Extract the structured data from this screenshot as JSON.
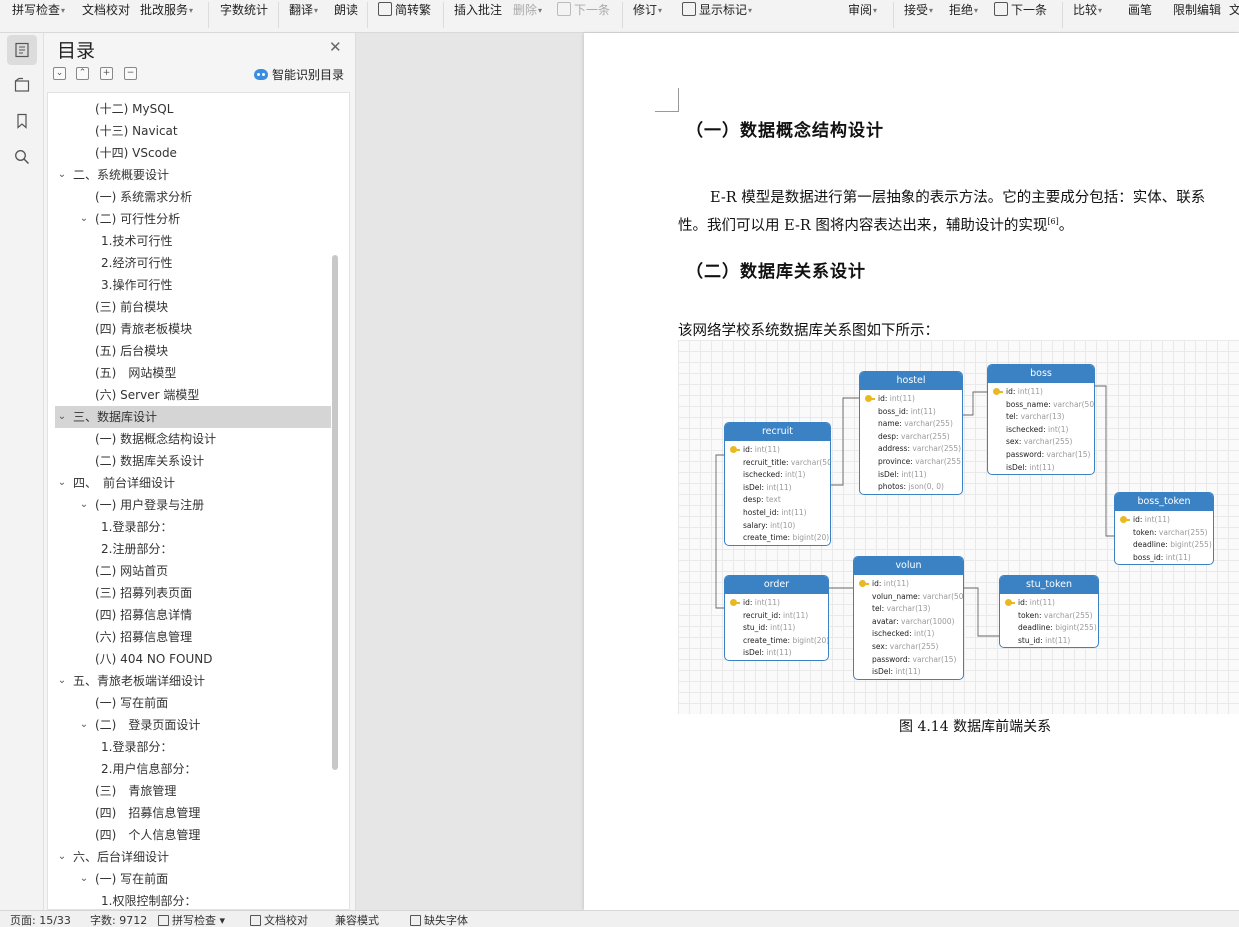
{
  "ribbon": {
    "spell_check": "拼写检查",
    "doc_proof": "文档校对",
    "batch_service": "批改服务",
    "word_count": "字数统计",
    "translate": "翻译",
    "read_aloud": "朗读",
    "simp_trad": "简转繁",
    "insert_comment": "插入批注",
    "delete": "删除",
    "next_comment": "下一条",
    "revise": "修订",
    "show_markup": "显示标记",
    "review": "审阅",
    "accept": "接受",
    "reject": "拒绝",
    "next_change": "下一条",
    "compare": "比较",
    "ink": "画笔",
    "restrict_edit": "限制编辑",
    "more": "文"
  },
  "toc": {
    "title": "目录",
    "smart_toc": "智能识别目录",
    "items": [
      {
        "label": "(十二) MySQL",
        "level": 2,
        "twisty": ""
      },
      {
        "label": "(十三) Navicat",
        "level": 2,
        "twisty": ""
      },
      {
        "label": "(十四) VScode",
        "level": 2,
        "twisty": ""
      },
      {
        "label": "二、系统概要设计",
        "level": 1,
        "twisty": "v"
      },
      {
        "label": "(一) 系统需求分析",
        "level": 2,
        "twisty": ""
      },
      {
        "label": "(二) 可行性分析",
        "level": 2,
        "twisty": "v"
      },
      {
        "label": "1.技术可行性",
        "level": 3,
        "twisty": ""
      },
      {
        "label": "2.经济可行性",
        "level": 3,
        "twisty": ""
      },
      {
        "label": "3.操作可行性",
        "level": 3,
        "twisty": ""
      },
      {
        "label": "(三) 前台模块",
        "level": 2,
        "twisty": ""
      },
      {
        "label": "(四) 青旅老板模块",
        "level": 2,
        "twisty": ""
      },
      {
        "label": "(五) 后台模块",
        "level": 2,
        "twisty": ""
      },
      {
        "label": "(五)　网站模型",
        "level": 2,
        "twisty": ""
      },
      {
        "label": "(六) Server 端模型",
        "level": 2,
        "twisty": ""
      },
      {
        "label": "三、数据库设计",
        "level": 1,
        "twisty": "v",
        "selected": true
      },
      {
        "label": "(一) 数据概念结构设计",
        "level": 2,
        "twisty": ""
      },
      {
        "label": "(二) 数据库关系设计",
        "level": 2,
        "twisty": ""
      },
      {
        "label": "四、　前台详细设计",
        "level": 1,
        "twisty": "v"
      },
      {
        "label": "(一) 用户登录与注册",
        "level": 2,
        "twisty": "v"
      },
      {
        "label": "1.登录部分：",
        "level": 3,
        "twisty": ""
      },
      {
        "label": "2.注册部分：",
        "level": 3,
        "twisty": ""
      },
      {
        "label": "(二) 网站首页",
        "level": 2,
        "twisty": ""
      },
      {
        "label": "(三) 招募列表页面",
        "level": 2,
        "twisty": ""
      },
      {
        "label": "(四) 招募信息详情",
        "level": 2,
        "twisty": ""
      },
      {
        "label": "(六) 招募信息管理",
        "level": 2,
        "twisty": ""
      },
      {
        "label": "(八) 404 NO FOUND",
        "level": 2,
        "twisty": ""
      },
      {
        "label": "五、青旅老板端详细设计",
        "level": 1,
        "twisty": "v"
      },
      {
        "label": "(一) 写在前面",
        "level": 2,
        "twisty": ""
      },
      {
        "label": "(二)　登录页面设计",
        "level": 2,
        "twisty": "v"
      },
      {
        "label": "1.登录部分：",
        "level": 3,
        "twisty": ""
      },
      {
        "label": "2.用户信息部分：",
        "level": 3,
        "twisty": ""
      },
      {
        "label": "(三)　青旅管理",
        "level": 2,
        "twisty": ""
      },
      {
        "label": "(四)　招募信息管理",
        "level": 2,
        "twisty": ""
      },
      {
        "label": "(四)　个人信息管理",
        "level": 2,
        "twisty": ""
      },
      {
        "label": "六、后台详细设计",
        "level": 1,
        "twisty": "v"
      },
      {
        "label": "(一) 写在前面",
        "level": 2,
        "twisty": "v"
      },
      {
        "label": "1.权限控制部分：",
        "level": 3,
        "twisty": ""
      }
    ]
  },
  "doc": {
    "heading1": "（一）数据概念结构设计",
    "para1_line1": "E-R 模型是数据进行第一层抽象的表示方法。它的主要成分包括：实体、联系",
    "para1_line2": "性。我们可以用 E-R 图将内容表达出来，辅助设计的实现",
    "para1_ref": "[6]",
    "para1_end": "。",
    "heading2": "（二）数据库关系设计",
    "para2": "该网络学校系统数据库关系图如下所示：",
    "caption": "图 4.14 数据库前端关系"
  },
  "er": {
    "entities": [
      {
        "name": "hostel",
        "fields": [
          {
            "n": "id",
            "t": "int(11)",
            "pk": true
          },
          {
            "n": "boss_id",
            "t": "int(11)"
          },
          {
            "n": "name",
            "t": "varchar(255)"
          },
          {
            "n": "desp",
            "t": "varchar(255)"
          },
          {
            "n": "address",
            "t": "varchar(255)"
          },
          {
            "n": "province",
            "t": "varchar(255)"
          },
          {
            "n": "isDel",
            "t": "int(11)"
          },
          {
            "n": "photos",
            "t": "json(0, 0)"
          }
        ]
      },
      {
        "name": "boss",
        "fields": [
          {
            "n": "id",
            "t": "int(11)",
            "pk": true
          },
          {
            "n": "boss_name",
            "t": "varchar(50)"
          },
          {
            "n": "tel",
            "t": "varchar(13)"
          },
          {
            "n": "ischecked",
            "t": "int(1)"
          },
          {
            "n": "sex",
            "t": "varchar(255)"
          },
          {
            "n": "password",
            "t": "varchar(15)"
          },
          {
            "n": "isDel",
            "t": "int(11)"
          }
        ]
      },
      {
        "name": "recruit",
        "fields": [
          {
            "n": "id",
            "t": "int(11)",
            "pk": true
          },
          {
            "n": "recruit_title",
            "t": "varchar(50)"
          },
          {
            "n": "ischecked",
            "t": "int(1)"
          },
          {
            "n": "isDel",
            "t": "int(11)"
          },
          {
            "n": "desp",
            "t": "text"
          },
          {
            "n": "hostel_id",
            "t": "int(11)"
          },
          {
            "n": "salary",
            "t": "int(10)"
          },
          {
            "n": "create_time",
            "t": "bigint(20)"
          }
        ]
      },
      {
        "name": "boss_token",
        "fields": [
          {
            "n": "id",
            "t": "int(11)",
            "pk": true
          },
          {
            "n": "token",
            "t": "varchar(255)"
          },
          {
            "n": "deadline",
            "t": "bigint(255)"
          },
          {
            "n": "boss_id",
            "t": "int(11)"
          }
        ]
      },
      {
        "name": "volun",
        "fields": [
          {
            "n": "id",
            "t": "int(11)",
            "pk": true
          },
          {
            "n": "volun_name",
            "t": "varchar(50)"
          },
          {
            "n": "tel",
            "t": "varchar(13)"
          },
          {
            "n": "avatar",
            "t": "varchar(1000)"
          },
          {
            "n": "ischecked",
            "t": "int(1)"
          },
          {
            "n": "sex",
            "t": "varchar(255)"
          },
          {
            "n": "password",
            "t": "varchar(15)"
          },
          {
            "n": "isDel",
            "t": "int(11)"
          }
        ]
      },
      {
        "name": "order",
        "fields": [
          {
            "n": "id",
            "t": "int(11)",
            "pk": true
          },
          {
            "n": "recruit_id",
            "t": "int(11)"
          },
          {
            "n": "stu_id",
            "t": "int(11)"
          },
          {
            "n": "create_time",
            "t": "bigint(20)"
          },
          {
            "n": "isDel",
            "t": "int(11)"
          }
        ]
      },
      {
        "name": "stu_token",
        "fields": [
          {
            "n": "id",
            "t": "int(11)",
            "pk": true
          },
          {
            "n": "token",
            "t": "varchar(255)"
          },
          {
            "n": "deadline",
            "t": "bigint(255)"
          },
          {
            "n": "stu_id",
            "t": "int(11)"
          }
        ]
      }
    ]
  },
  "status": {
    "page": "页面: 15/33",
    "words": "字数: 9712",
    "spell_check": "拼写检查",
    "doc_proof": "文档校对",
    "compat_mode": "兼容模式",
    "missing_font": "缺失字体"
  },
  "colors": {
    "accent": "#3b82c4",
    "toc_selected": "#d5d5d5"
  }
}
